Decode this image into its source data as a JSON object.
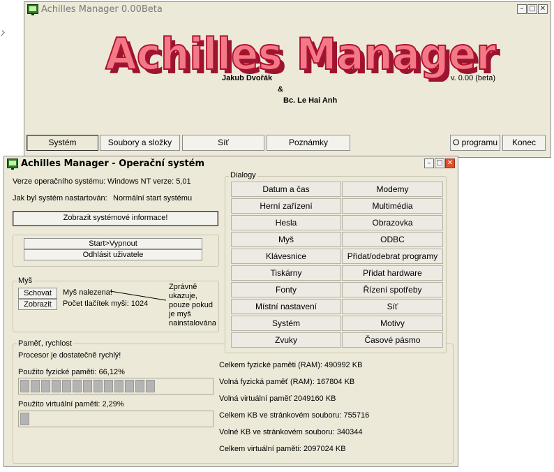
{
  "main_window": {
    "title": "Achilles Manager 0.00Beta",
    "logo_text": "Achilles Manager",
    "author1": "Jakub Dvořák",
    "ampersand": "&",
    "author2": "Bc. Le Hai Anh",
    "version": "v. 0.00 (beta)",
    "menu": {
      "system": "Systém",
      "files": "Soubory a složky",
      "network": "Síť",
      "notes": "Poznámky",
      "about": "O programu",
      "exit": "Konec"
    },
    "controls": {
      "minimize": "–",
      "maximize": "□",
      "close": "✕"
    }
  },
  "os_window": {
    "title": "Achilles Manager - Operační systém",
    "os_version_label": "Verze operačního systému:",
    "os_version_value": "Windows NT verze: 5,01",
    "boot_label": "Jak byl systém nastartován:",
    "boot_value": "Normální start systému",
    "show_info_button": "Zobrazit systémové informace!",
    "start_button": "Start>Vypnout",
    "logoff_button": "Odhlásit uživatele",
    "mouse_group": {
      "label": "Myš",
      "hide_button": "Schovat",
      "show_button": "Zobrazit",
      "found_text": "Myš nalezena!",
      "buttons_count": "Počet tlačítek myši: 1024",
      "note_lines": [
        "Zprávně",
        "ukazuje,",
        "pouze pokud",
        "je myš",
        "nainstalována"
      ]
    },
    "memory_group": {
      "label": "Paměť, rychlost",
      "cpu_status": "Procesor je dostatečně rychlý!",
      "physical_label": "Použito fyzické paměti: 66,12%",
      "physical_percent": 66.12,
      "virtual_label": "Použito virtuální paměti: 2,29%",
      "virtual_percent": 2.29,
      "stats": [
        "Celkem fyzické paměti (RAM): 490992 KB",
        "Volná fyzická paměť (RAM): 167804 KB",
        "Volná virtuální paměť 2049160 KB",
        "Celkem KB ve stránkovém souboru: 755716",
        "Volné KB ve stránkovém souboru: 340344",
        "Celkem virtuální paměti: 2097024 KB"
      ]
    },
    "dialogs": {
      "label": "Dialogy",
      "left": [
        "Datum a čas",
        "Herní zařízení",
        "Hesla",
        "Myš",
        "Klávesnice",
        "Tiskárny",
        "Fonty",
        "Místní nastavení",
        "Systém",
        "Zvuky"
      ],
      "right": [
        "Modemy",
        "Multimédia",
        "Obrazovka",
        "ODBC",
        "Přidat/odebrat programy",
        "Přidat hardware",
        "Řízení spotřeby",
        "Síť",
        "Motivy",
        "Časové pásmo"
      ]
    },
    "controls": {
      "minimize": "–",
      "maximize": "□",
      "close": "✕"
    }
  },
  "colors": {
    "logo_fill": "#f27a86",
    "logo_stroke": "#b01030",
    "window_bg": "#ece9d8",
    "progress_segment": "#b4b4b4"
  }
}
